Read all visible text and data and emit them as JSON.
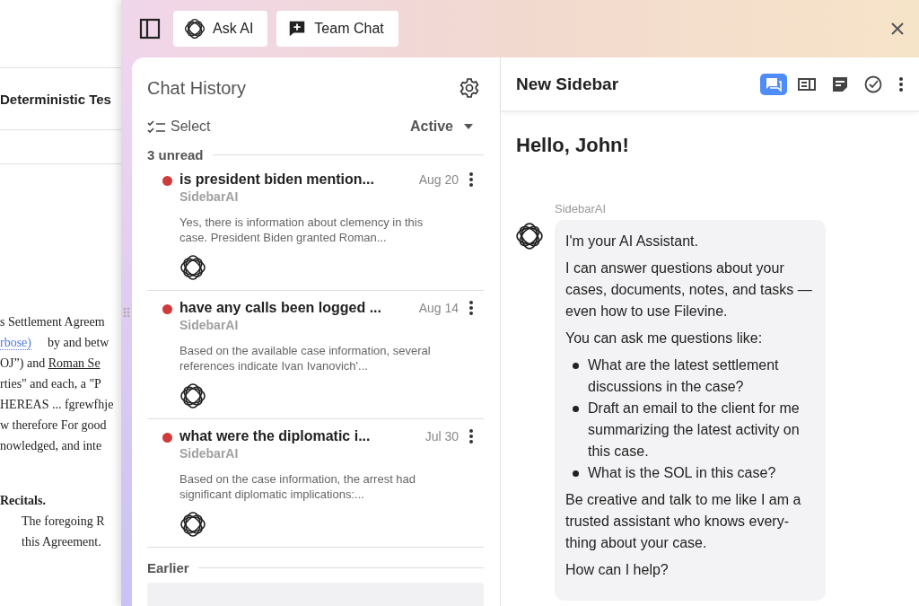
{
  "document": {
    "heading": "Deterministic Tes",
    "lines": [
      {
        "kind": "gap"
      },
      {
        "kind": "text",
        "text": "s Settlement Agreem"
      },
      {
        "kind": "mixed",
        "link": "rbose)",
        "text": "by and betw"
      },
      {
        "kind": "underlined",
        "text": "OJ”) and ",
        "underlined": "Roman Se"
      },
      {
        "kind": "text",
        "text": "rties\" and each, a \"P"
      },
      {
        "kind": "text",
        "text": "HEREAS ... fgrewfhje"
      },
      {
        "kind": "text",
        "text": "w therefore For good"
      },
      {
        "kind": "text",
        "text": "nowledged, and inte"
      },
      {
        "kind": "gap"
      },
      {
        "kind": "bold",
        "text": "Recitals."
      },
      {
        "kind": "indent",
        "text": "The foregoing R"
      },
      {
        "kind": "indent",
        "text": "this Agreement."
      }
    ]
  },
  "toolbar": {
    "buttons": [
      {
        "kind": "ai",
        "label": "Ask AI"
      },
      {
        "kind": "chat",
        "label": "Team Chat"
      }
    ]
  },
  "chat_history": {
    "title": "Chat History",
    "select_label": "Select",
    "filter": "Active",
    "groups": [
      {
        "label": "3 unread",
        "items": [
          {
            "title": "is president biden mention...",
            "date": "Aug 20",
            "source": "SidebarAI",
            "preview": "Yes, there is information about clemency in this case. President Biden granted Roman...",
            "unread": true
          },
          {
            "title": "have any calls been logged ...",
            "date": "Aug 14",
            "source": "SidebarAI",
            "preview": "Based on the available case information, several references indicate Ivan Ivanovich'...",
            "unread": true
          },
          {
            "title": "what were the diplomatic i...",
            "date": "Jul 30",
            "source": "SidebarAI",
            "preview": "Based on the case information, the arrest had significant diplomatic implications:...",
            "unread": true
          }
        ]
      },
      {
        "label": "Earlier",
        "items": [
          {
            "kind": "cut",
            "selected": true
          }
        ]
      }
    ]
  },
  "sidebar": {
    "title": "New Sidebar",
    "tabs": [
      {
        "kind": "chat",
        "selected": true
      },
      {
        "kind": "panel",
        "selected": false
      },
      {
        "kind": "note",
        "selected": false
      },
      {
        "kind": "check",
        "selected": false
      }
    ],
    "greeting": "Hello, John!",
    "message": {
      "sender": "SidebarAI",
      "blocks": [
        {
          "kind": "p",
          "text": "I'm your AI Assistant."
        },
        {
          "kind": "p",
          "text": "I can answer questions about your cases, documents, notes, and tasks —even how to use Filevine."
        },
        {
          "kind": "p",
          "text": "You can ask me questions like:"
        },
        {
          "kind": "list",
          "items": [
            "What are the latest settlement discussions in the case?",
            "Draft an email to the client for me summarizing the latest activity on this case.",
            "What is the SOL in this case?"
          ]
        },
        {
          "kind": "p",
          "text": "Be creative and talk to me like I am a trusted assistant who knows every-thing about your case."
        },
        {
          "kind": "p",
          "text": "How can I help?"
        }
      ]
    }
  }
}
